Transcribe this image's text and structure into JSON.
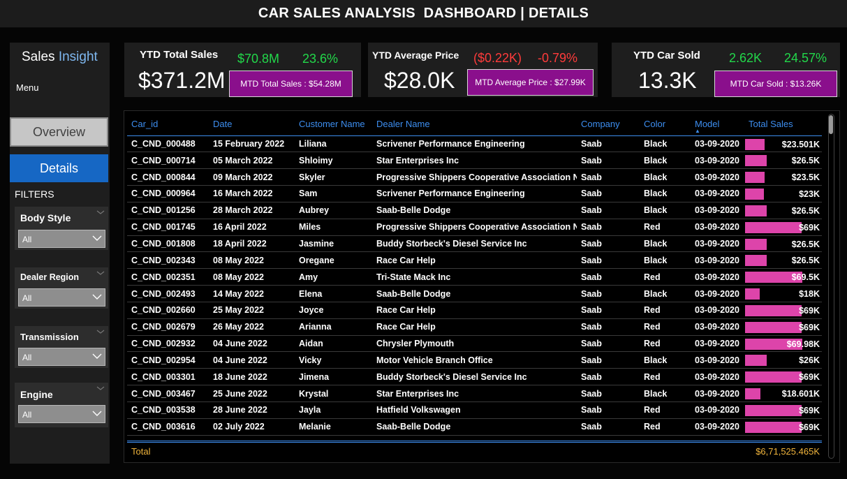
{
  "header": {
    "title": "CAR SALES ANALYSIS  DASHBOARD | DETAILS"
  },
  "sidebar": {
    "brand_part1": "Sales ",
    "brand_part2": "Insight",
    "menu_label": "Menu",
    "nav_overview": "Overview",
    "nav_details": "Details",
    "filters_label": "FILTERS",
    "filters": [
      {
        "title": "Body Style",
        "value": "All"
      },
      {
        "title": "Dealer Region",
        "value": "All"
      },
      {
        "title": "Transmission",
        "value": "All"
      },
      {
        "title": "Engine",
        "value": "All"
      }
    ]
  },
  "kpis": {
    "sales": {
      "label": "YTD Total Sales",
      "value": "$371.2M",
      "delta_abs": "$70.8M",
      "delta_pct": "23.6%",
      "mtd": "MTD Total Sales : $54.28M"
    },
    "price": {
      "label": "YTD Average Price",
      "value": "$28.0K",
      "delta_abs": "($0.22K)",
      "delta_pct": "-0.79%",
      "mtd": "MTD Average Price : $27.99K"
    },
    "sold": {
      "label": "YTD Car Sold",
      "value": "13.3K",
      "delta_abs": "2.62K",
      "delta_pct": "24.57%",
      "mtd": "MTD Car Sold : $13.26K"
    }
  },
  "colors": {
    "accent": "#1667c4",
    "header_blue": "#3d8ef0",
    "mtd_purple": "#8a0f8c",
    "bar_pink": "#dd44aa",
    "positive": "#22d84a",
    "negative": "#ff3b3b",
    "total": "#f0b43c"
  },
  "table": {
    "columns": [
      "Car_id",
      "Date",
      "Customer Name",
      "Dealer Name",
      "Company",
      "Color",
      "Model",
      "Total Sales"
    ],
    "sorted_column": "Model",
    "sort_indicator": "▲",
    "rows": [
      {
        "car_id": "C_CND_000488",
        "date": "15 February 2022",
        "customer": "Liliana",
        "dealer": "Scrivener Performance Engineering",
        "company": "Saab",
        "color": "Black",
        "model": "03-09-2020",
        "sales": "$23.501K",
        "sales_value": 23501
      },
      {
        "car_id": "C_CND_000714",
        "date": "05 March 2022",
        "customer": "Shloimy",
        "dealer": "Star Enterprises Inc",
        "company": "Saab",
        "color": "Black",
        "model": "03-09-2020",
        "sales": "$26.5K",
        "sales_value": 26500
      },
      {
        "car_id": "C_CND_000844",
        "date": "09 March 2022",
        "customer": "Skyler",
        "dealer": "Progressive Shippers Cooperative Association No",
        "company": "Saab",
        "color": "Black",
        "model": "03-09-2020",
        "sales": "$23.5K",
        "sales_value": 23500
      },
      {
        "car_id": "C_CND_000964",
        "date": "16 March 2022",
        "customer": "Sam",
        "dealer": "Scrivener Performance Engineering",
        "company": "Saab",
        "color": "Black",
        "model": "03-09-2020",
        "sales": "$23K",
        "sales_value": 23000
      },
      {
        "car_id": "C_CND_001256",
        "date": "28 March 2022",
        "customer": "Aubrey",
        "dealer": "Saab-Belle Dodge",
        "company": "Saab",
        "color": "Black",
        "model": "03-09-2020",
        "sales": "$26.5K",
        "sales_value": 26500
      },
      {
        "car_id": "C_CND_001745",
        "date": "16 April 2022",
        "customer": "Miles",
        "dealer": "Progressive Shippers Cooperative Association No",
        "company": "Saab",
        "color": "Red",
        "model": "03-09-2020",
        "sales": "$69K",
        "sales_value": 69000
      },
      {
        "car_id": "C_CND_001808",
        "date": "18 April 2022",
        "customer": "Jasmine",
        "dealer": "Buddy Storbeck's Diesel Service Inc",
        "company": "Saab",
        "color": "Black",
        "model": "03-09-2020",
        "sales": "$26.5K",
        "sales_value": 26500
      },
      {
        "car_id": "C_CND_002343",
        "date": "08 May 2022",
        "customer": "Oregane",
        "dealer": "Race Car Help",
        "company": "Saab",
        "color": "Black",
        "model": "03-09-2020",
        "sales": "$26.5K",
        "sales_value": 26500
      },
      {
        "car_id": "C_CND_002351",
        "date": "08 May 2022",
        "customer": "Amy",
        "dealer": "Tri-State Mack Inc",
        "company": "Saab",
        "color": "Red",
        "model": "03-09-2020",
        "sales": "$69.5K",
        "sales_value": 69500
      },
      {
        "car_id": "C_CND_002493",
        "date": "14 May 2022",
        "customer": "Elena",
        "dealer": "Saab-Belle Dodge",
        "company": "Saab",
        "color": "Black",
        "model": "03-09-2020",
        "sales": "$18K",
        "sales_value": 18000
      },
      {
        "car_id": "C_CND_002660",
        "date": "25 May 2022",
        "customer": "Joyce",
        "dealer": "Race Car Help",
        "company": "Saab",
        "color": "Red",
        "model": "03-09-2020",
        "sales": "$69K",
        "sales_value": 69000
      },
      {
        "car_id": "C_CND_002679",
        "date": "26 May 2022",
        "customer": "Arianna",
        "dealer": "Race Car Help",
        "company": "Saab",
        "color": "Red",
        "model": "03-09-2020",
        "sales": "$69K",
        "sales_value": 69000
      },
      {
        "car_id": "C_CND_002932",
        "date": "04 June 2022",
        "customer": "Aidan",
        "dealer": "Chrysler Plymouth",
        "company": "Saab",
        "color": "Red",
        "model": "03-09-2020",
        "sales": "$69.98K",
        "sales_value": 69980
      },
      {
        "car_id": "C_CND_002954",
        "date": "04 June 2022",
        "customer": "Vicky",
        "dealer": "Motor Vehicle Branch Office",
        "company": "Saab",
        "color": "Black",
        "model": "03-09-2020",
        "sales": "$26K",
        "sales_value": 26000
      },
      {
        "car_id": "C_CND_003301",
        "date": "18 June 2022",
        "customer": "Jimena",
        "dealer": "Buddy Storbeck's Diesel Service Inc",
        "company": "Saab",
        "color": "Red",
        "model": "03-09-2020",
        "sales": "$69K",
        "sales_value": 69000
      },
      {
        "car_id": "C_CND_003467",
        "date": "25 June 2022",
        "customer": "Krystal",
        "dealer": "Star Enterprises Inc",
        "company": "Saab",
        "color": "Black",
        "model": "03-09-2020",
        "sales": "$18.601K",
        "sales_value": 18601
      },
      {
        "car_id": "C_CND_003538",
        "date": "28 June 2022",
        "customer": "Jayla",
        "dealer": "Hatfield Volkswagen",
        "company": "Saab",
        "color": "Red",
        "model": "03-09-2020",
        "sales": "$69K",
        "sales_value": 69000
      },
      {
        "car_id": "C_CND_003616",
        "date": "02 July 2022",
        "customer": "Melanie",
        "dealer": "Saab-Belle Dodge",
        "company": "Saab",
        "color": "Red",
        "model": "03-09-2020",
        "sales": "$69K",
        "sales_value": 69000
      }
    ],
    "sales_bar_max": 85000,
    "total_label": "Total",
    "total_value": "$6,71,525.465K"
  }
}
